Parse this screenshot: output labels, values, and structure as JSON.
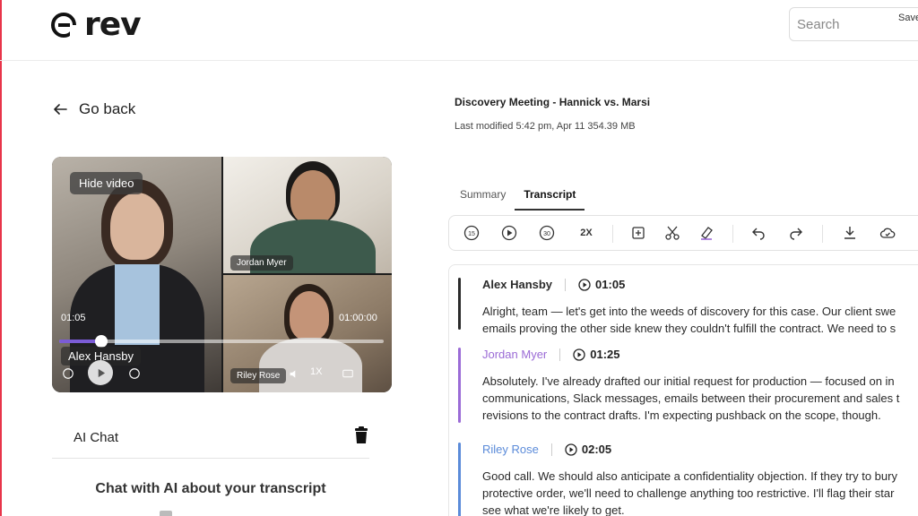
{
  "brand": {
    "logo_text": "rev"
  },
  "search": {
    "placeholder": "Search"
  },
  "nav": {
    "go_back_label": "Go back"
  },
  "video": {
    "hide_video_label": "Hide video",
    "current_time": "01:05",
    "duration": "01:00:00",
    "progress_fraction": 0.13,
    "speed_label": "1X",
    "participants": [
      "Alex Hansby",
      "Jordan Myer",
      "Riley Rose"
    ]
  },
  "ai_chat": {
    "label": "AI Chat",
    "title": "Chat with AI about your transcript"
  },
  "meeting": {
    "title": "Discovery Meeting - Hannick vs. Marsi",
    "meta": "Last modified 5:42 pm, Apr 11 354.39 MB"
  },
  "tabs": [
    {
      "label": "Summary",
      "active": false
    },
    {
      "label": "Transcript",
      "active": true
    }
  ],
  "toolbar": {
    "rewind_label": "15",
    "forward_label": "30",
    "speed_label": "2X",
    "save_label": "Save"
  },
  "transcript": [
    {
      "speaker": "Alex Hansby",
      "time": "01:05",
      "color": "#2b2b2b",
      "text": "Alright, team — let's get into the weeds of discovery for this case. Our client swe\nemails proving the other side knew they couldn't fulfill the contract. We need to s"
    },
    {
      "speaker": "Jordan Myer",
      "time": "01:25",
      "color": "#9b6bd6",
      "text": "Absolutely. I've already drafted our initial request for production — focused on in\ncommunications, Slack messages, emails between their procurement and sales t\nrevisions to the contract drafts. I'm expecting pushback on the scope, though."
    },
    {
      "speaker": "Riley Rose",
      "time": "02:05",
      "color": "#5b8bd9",
      "text": "Good call. We should also anticipate a confidentiality objection. If they try to bury\nprotective order, we'll need to challenge anything too restrictive. I'll flag their star\nsee what we're likely to get."
    }
  ],
  "colors": {
    "accent": "#7b5cd6",
    "edge": "#e8344a"
  }
}
